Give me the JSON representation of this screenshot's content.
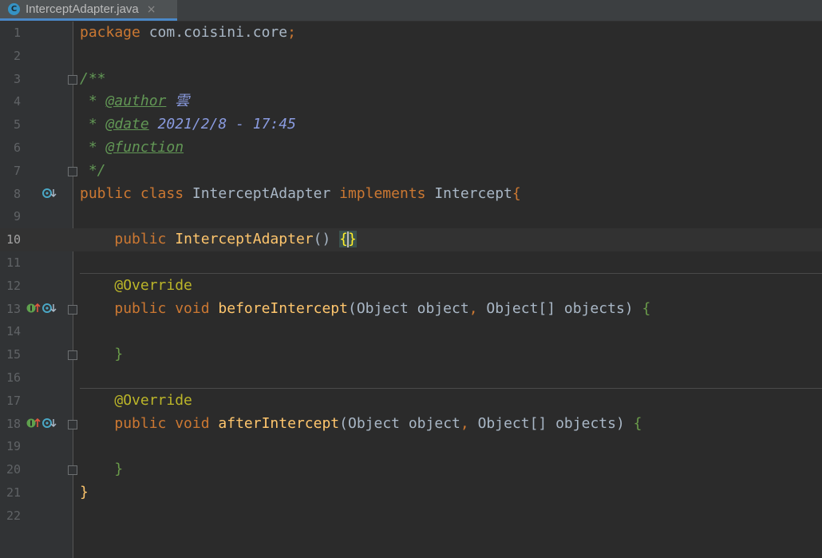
{
  "tab": {
    "icon_letter": "C",
    "title": "InterceptAdapter.java",
    "close": "×"
  },
  "code": {
    "l1": {
      "kw": "package",
      "text": " com.coisini.core",
      "semi": ";"
    },
    "l3": "/**",
    "l4": {
      "star": " * ",
      "tag": "@author",
      "val": " 雲"
    },
    "l5": {
      "star": " * ",
      "tag": "@date",
      "val": " 2021/2/8 - 17:45"
    },
    "l6": {
      "star": " * ",
      "tag": "@function"
    },
    "l7": " */",
    "l8": {
      "kw1": "public class",
      "name": " InterceptAdapter ",
      "kw2": "implements",
      "iface": " Intercept",
      "brace": "{"
    },
    "l10": {
      "kw": "public",
      "fn": " InterceptAdapter",
      "paren": "() ",
      "b1": "{",
      "b2": "}"
    },
    "l12": "@Override",
    "l13": {
      "kw": "public void",
      "fn": " beforeIntercept",
      "p1": "(",
      "t1": "Object object",
      "comma": ", ",
      "t2": "Object[] objects",
      "p2": ") ",
      "brace": "{"
    },
    "l15": "}",
    "l17": "@Override",
    "l18": {
      "kw": "public void",
      "fn": " afterIntercept",
      "p1": "(",
      "t1": "Object object",
      "comma": ", ",
      "t2": "Object[] objects",
      "p2": ") ",
      "brace": "{"
    },
    "l20": "}",
    "l21": "}"
  },
  "line_numbers": [
    "1",
    "2",
    "3",
    "4",
    "5",
    "6",
    "7",
    "8",
    "9",
    "10",
    "11",
    "12",
    "13",
    "14",
    "15",
    "16",
    "17",
    "18",
    "19",
    "20",
    "21",
    "22"
  ],
  "gutter_markers": {
    "implemented_icon": "implemented-icon",
    "implements_icon": "implements-method-icon",
    "arrow_up": "↑",
    "arrow_down": "↓",
    "i_letter": "I",
    "o_letter": "o"
  }
}
